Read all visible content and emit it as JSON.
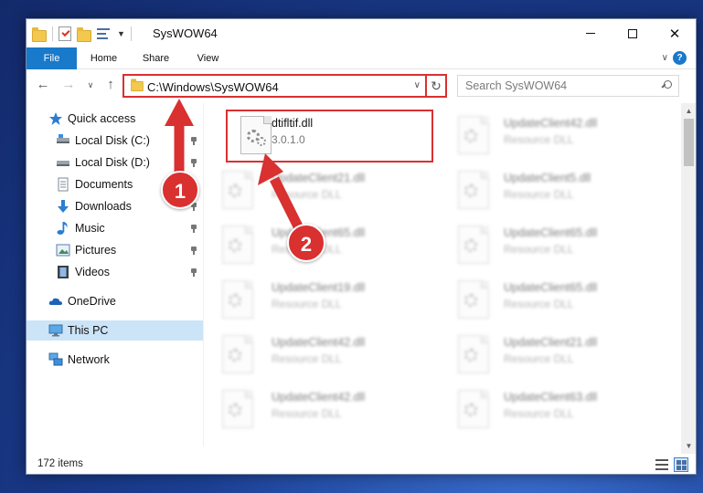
{
  "window": {
    "title": "SysWOW64"
  },
  "ribbon": {
    "tabs": [
      {
        "id": "file",
        "label": "File"
      },
      {
        "id": "home",
        "label": "Home"
      },
      {
        "id": "share",
        "label": "Share"
      },
      {
        "id": "view",
        "label": "View"
      }
    ]
  },
  "navigation": {
    "address": "C:\\Windows\\SysWOW64",
    "search_placeholder": "Search SysWOW64"
  },
  "sidebar": {
    "items": [
      {
        "label": "Quick access",
        "icon": "star-icon",
        "pinned": false
      },
      {
        "label": "Local Disk (C:)",
        "icon": "drive-icon",
        "pinned": true
      },
      {
        "label": "Local Disk (D:)",
        "icon": "drive-icon",
        "pinned": true
      },
      {
        "label": "Documents",
        "icon": "documents-icon",
        "pinned": true
      },
      {
        "label": "Downloads",
        "icon": "downloads-icon",
        "pinned": true
      },
      {
        "label": "Music",
        "icon": "music-icon",
        "pinned": true
      },
      {
        "label": "Pictures",
        "icon": "pictures-icon",
        "pinned": true
      },
      {
        "label": "Videos",
        "icon": "videos-icon",
        "pinned": true
      },
      {
        "label": "OneDrive",
        "icon": "cloud-icon",
        "pinned": false
      },
      {
        "label": "This PC",
        "icon": "monitor-icon",
        "pinned": false,
        "selected": true
      },
      {
        "label": "Network",
        "icon": "network-icon",
        "pinned": false
      }
    ]
  },
  "files": [
    {
      "name": "dtifltif.dll",
      "sub": "3.0.1.0",
      "highlighted": true
    },
    {
      "name": "UpdateClient42.dll",
      "sub": "Resource DLL"
    },
    {
      "name": "UpdateClient21.dll",
      "sub": "Resource DLL"
    },
    {
      "name": "UpdateClient5.dll",
      "sub": "Resource DLL"
    },
    {
      "name": "UpdateClient65.dll",
      "sub": "Resource DLL"
    },
    {
      "name": "UpdateClient65.dll",
      "sub": "Resource DLL"
    },
    {
      "name": "UpdateClient19.dll",
      "sub": "Resource DLL"
    },
    {
      "name": "UpdateClient65.dll",
      "sub": "Resource DLL"
    },
    {
      "name": "UpdateClient42.dll",
      "sub": "Resource DLL"
    },
    {
      "name": "UpdateClient21.dll",
      "sub": "Resource DLL"
    },
    {
      "name": "UpdateClient42.dll",
      "sub": "Resource DLL"
    },
    {
      "name": "UpdateClient63.dll",
      "sub": "Resource DLL"
    }
  ],
  "status": {
    "item_count": "172 items"
  },
  "annotations": [
    {
      "number": "1"
    },
    {
      "number": "2"
    }
  ],
  "colors": {
    "accent": "#1979ca",
    "highlight": "#d93030",
    "selection": "#cce4f7"
  }
}
